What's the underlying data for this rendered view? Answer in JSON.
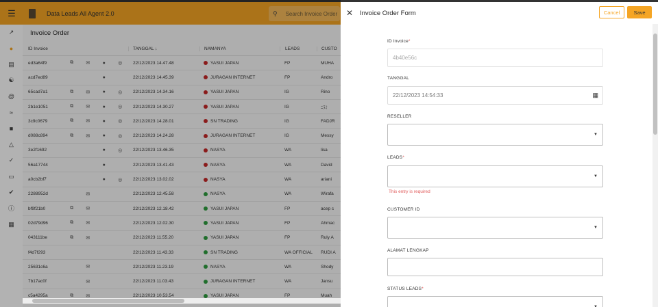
{
  "app": {
    "title": "Data Leads All Agent 2.0",
    "search_placeholder": "Search Invoice Order"
  },
  "main": {
    "title": "Invoice Order",
    "columns": {
      "id": "ID Invoice",
      "date": "TANGGAL ↓",
      "name": "NAMANYA",
      "leads": "LEADS",
      "cust": "CUSTO"
    },
    "rows": [
      {
        "id": "ed3a64f9",
        "date": "22/12/2023 14.47.48",
        "name": "YASUI JAPAN",
        "status": "red",
        "leads": "FP",
        "cust": "MUHA",
        "icons": [
          "ext",
          "mail",
          "check",
          "circle"
        ]
      },
      {
        "id": "acd7ed89",
        "date": "22/12/2023 14.45.39",
        "name": "JURAGAN INTERNET",
        "status": "red",
        "leads": "FP",
        "cust": "Andro",
        "icons": [
          "",
          "",
          "check",
          ""
        ]
      },
      {
        "id": "65cad7a1",
        "date": "22/12/2023 14.34.16",
        "name": "YASUI JAPAN",
        "status": "red",
        "leads": "IG",
        "cust": "Rino",
        "icons": [
          "ext",
          "mail",
          "check",
          "circle"
        ]
      },
      {
        "id": "2b1e1051",
        "date": "22/12/2023 14.30.27",
        "name": "YASUI JAPAN",
        "status": "red",
        "leads": "IG",
        "cust": "ﾆﾗﾐ",
        "icons": [
          "ext",
          "mail",
          "check",
          "circle"
        ]
      },
      {
        "id": "3c9c0679",
        "date": "22/12/2023 14.28.01",
        "name": "SN TRADING",
        "status": "red",
        "leads": "IG",
        "cust": "FADJR",
        "icons": [
          "ext",
          "mail",
          "check",
          "circle"
        ]
      },
      {
        "id": "d088c894",
        "date": "22/12/2023 14.24.28",
        "name": "JURAGAN INTERNET",
        "status": "red",
        "leads": "IG",
        "cust": "Messy",
        "icons": [
          "ext",
          "mail",
          "check",
          "circle"
        ]
      },
      {
        "id": "3e2f1692",
        "date": "22/12/2023 13.46.35",
        "name": "NASYA",
        "status": "red",
        "leads": "WA",
        "cust": "lisa",
        "icons": [
          "",
          "",
          "check",
          "circle"
        ]
      },
      {
        "id": "56a17744",
        "date": "22/12/2023 13.41.43",
        "name": "NASYA",
        "status": "red",
        "leads": "WA",
        "cust": "David",
        "icons": [
          "",
          "",
          "check",
          ""
        ]
      },
      {
        "id": "a0cb2bf7",
        "date": "22/12/2023 13.02.02",
        "name": "NASYA",
        "status": "red",
        "leads": "WA",
        "cust": "ariani",
        "icons": [
          "",
          "",
          "check",
          "circle"
        ]
      },
      {
        "id": "2288952d",
        "date": "22/12/2023 12.45.58",
        "name": "NASYA",
        "status": "green",
        "leads": "WA",
        "cust": "Wirafa",
        "icons": [
          "",
          "mail",
          "",
          ""
        ]
      },
      {
        "id": "bf9f21b0",
        "date": "22/12/2023 12.18.42",
        "name": "YASUI JAPAN",
        "status": "green",
        "leads": "FP",
        "cust": "acep c",
        "icons": [
          "ext",
          "mail",
          "",
          ""
        ]
      },
      {
        "id": "02d79d96",
        "date": "22/12/2023 12.02.30",
        "name": "YASUI JAPAN",
        "status": "green",
        "leads": "FP",
        "cust": "Ahmac",
        "icons": [
          "ext",
          "mail",
          "",
          ""
        ]
      },
      {
        "id": "043111be",
        "date": "22/12/2023 11.55.20",
        "name": "YASUI JAPAN",
        "status": "green",
        "leads": "FP",
        "cust": "Ruly A",
        "icons": [
          "ext",
          "mail",
          "",
          ""
        ]
      },
      {
        "id": "f4d7f293",
        "date": "22/12/2023 11.43.33",
        "name": "SN TRADING",
        "status": "green",
        "leads": "WA OFFICIAL",
        "cust": "RUDI A",
        "icons": [
          "",
          "",
          "",
          ""
        ]
      },
      {
        "id": "25631c6a",
        "date": "22/12/2023 11.23.19",
        "name": "NASYA",
        "status": "green",
        "leads": "WA",
        "cust": "Shody",
        "icons": [
          "",
          "mail",
          "",
          ""
        ]
      },
      {
        "id": "7b17ac0f",
        "date": "22/12/2023 11.03.43",
        "name": "JURAGAN INTERNET",
        "status": "green",
        "leads": "WA",
        "cust": "Jansu",
        "icons": [
          "",
          "mail",
          "",
          ""
        ]
      },
      {
        "id": "c5a4295a",
        "date": "22/12/2023 10.53.54",
        "name": "YASUI JAPAN",
        "status": "green",
        "leads": "FP",
        "cust": "Muah",
        "icons": [
          "ext",
          "mail",
          "",
          ""
        ]
      }
    ]
  },
  "drawer": {
    "title": "Invoice Order Form",
    "cancel_label": "Cancel",
    "save_label": "Save",
    "fields": {
      "id_invoice": {
        "label": "ID Invoice",
        "value": "4b40e56c"
      },
      "tanggal": {
        "label": "TANGGAL",
        "value": "22/12/2023  14:54:33"
      },
      "reseller": {
        "label": "RESELLER"
      },
      "leads": {
        "label": "LEADS",
        "error": "This entry is required"
      },
      "customer_id": {
        "label": "CUSTOMER ID"
      },
      "alamat": {
        "label": "ALAMAT LENGKAP"
      },
      "status_leads": {
        "label": "STATUS LEADS"
      }
    },
    "required_mark": "*"
  },
  "colors": {
    "accent": "#f5a524",
    "status_red": "#c62828",
    "status_green": "#2e9e3f",
    "error": "#e05a5a"
  },
  "icons": {
    "ext": "external-link-icon",
    "mail": "mail-icon",
    "check": "check-circle-icon",
    "circle": "circle-check-outline-icon"
  }
}
